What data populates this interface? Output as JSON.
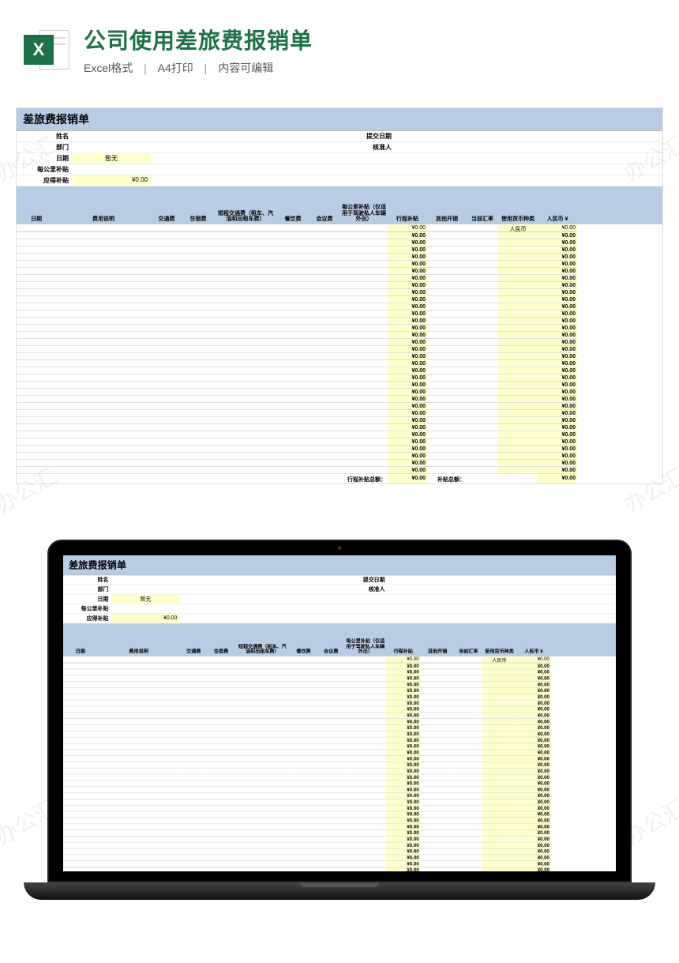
{
  "header": {
    "icon_letter": "X",
    "title": "公司使用差旅费报销单",
    "meta_format": "Excel格式",
    "meta_print": "A4打印",
    "meta_editable": "内容可编辑"
  },
  "watermark": "办公汇",
  "sheet": {
    "title": "差旅费报销单",
    "info": {
      "name_label": "姓名",
      "dept_label": "部门",
      "date_label": "日期",
      "date_value": "暂无",
      "per_km_label": "每公里补贴",
      "allowance_label": "应得补贴",
      "allowance_value": "¥0.00",
      "submit_date_label": "提交日期",
      "approver_label": "核准人"
    },
    "columns": {
      "date": "日期",
      "desc": "费用说明",
      "transport": "交通费",
      "lodging": "住宿费",
      "short_transport": "短程交通费（租车、汽油和出租车费）",
      "meals": "餐饮费",
      "meeting": "会议费",
      "per_km": "每公里补贴（仅适用于驾驶私人车辆外出）",
      "trip_allowance": "行程补贴",
      "other": "其他开销",
      "rate": "当前汇率",
      "currency_type": "使用货币种类",
      "rmb": "人民币 ¥"
    },
    "currency_default": "人民币",
    "calc_value": "¥0.00",
    "row_count": 34,
    "totals": {
      "trip_total_label": "行程补贴总额：",
      "trip_total_value": "¥0.00",
      "allowance_total_label": "补贴总额：",
      "rmb_total_value": "¥0.00"
    }
  }
}
